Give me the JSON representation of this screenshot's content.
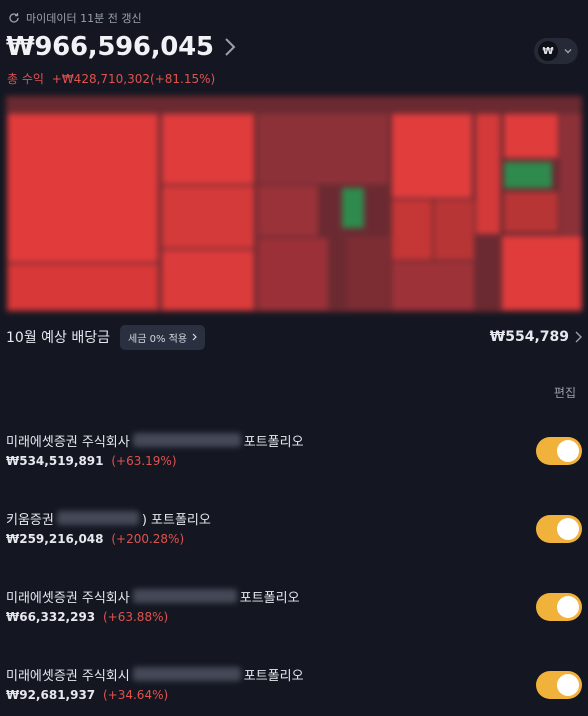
{
  "header": {
    "refresh_text": "마이데이터 11분 전 갱신",
    "total_value": "₩966,596,045",
    "profit_label": "총 수익",
    "profit_value": "+₩428,710,302(+81.15%)",
    "currency_symbol": "₩"
  },
  "dividend": {
    "label": "10월 예상 배당금",
    "tax_chip": "세금 0% 적용",
    "amount": "₩554,789"
  },
  "edit_label": "편집",
  "accounts": [
    {
      "broker": "미래에셋증권 주식회사",
      "suffix": "포트폴리오",
      "value": "₩534,519,891",
      "change": "(+63.19%)",
      "enabled": true
    },
    {
      "broker": "키움증권",
      "suffix": ") 포트폴리오",
      "value": "₩259,216,048",
      "change": "(+200.28%)",
      "enabled": true
    },
    {
      "broker": "미래에셋증권 주식회사",
      "suffix": "포트폴리오",
      "value": "₩66,332,293",
      "change": "(+63.88%)",
      "enabled": true
    },
    {
      "broker": "미래에셋증권 주식회시",
      "suffix": "포트폴리오",
      "value": "₩92,681,937",
      "change": "(+34.64%)",
      "enabled": true
    }
  ],
  "colors": {
    "background": "#141722",
    "profit_red": "#e0524d",
    "toggle_on": "#f0b23b",
    "tile_red": "#e04040",
    "tile_dark_red": "#7a2c33",
    "tile_green": "#2e8b50"
  },
  "icons": {
    "refresh": "refresh-icon",
    "chevron": "chevron-right-icon",
    "dropdown": "chevron-down-icon"
  }
}
